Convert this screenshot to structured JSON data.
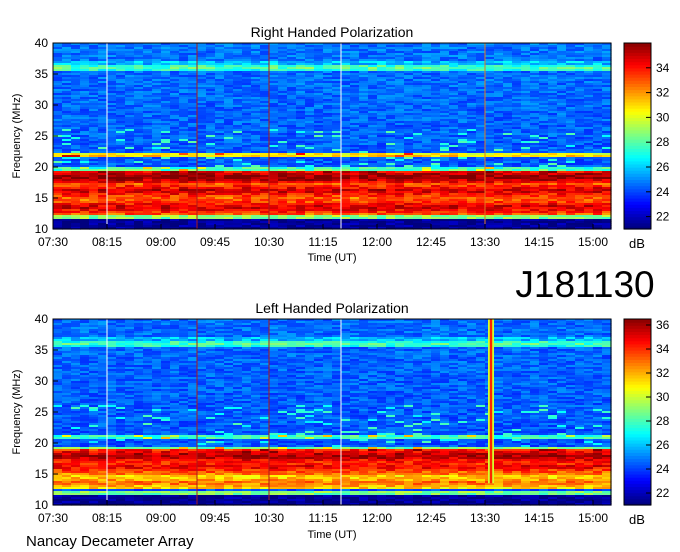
{
  "header": {
    "observation_id": "J181130"
  },
  "footer": {
    "instrument": "Nancay Decameter Array"
  },
  "chart_data": [
    {
      "type": "heatmap",
      "title": "Right Handed Polarization",
      "xlabel": "Time (UT)",
      "ylabel": "Frequency (MHz)",
      "x_ticks": [
        "07:30",
        "08:15",
        "09:00",
        "09:45",
        "10:30",
        "11:15",
        "12:00",
        "12:45",
        "13:30",
        "14:15",
        "15:00"
      ],
      "xlim": [
        "07:30",
        "15:15"
      ],
      "y_ticks": [
        10,
        15,
        20,
        25,
        30,
        35,
        40
      ],
      "ylim": [
        10,
        40
      ],
      "colorbar": {
        "label": "dB",
        "ticks": [
          22,
          24,
          26,
          28,
          30,
          32,
          34
        ],
        "range": [
          21,
          36
        ]
      },
      "colormap": [
        "#00007f",
        "#0000ff",
        "#007fff",
        "#00ffff",
        "#7fff7f",
        "#ffff00",
        "#ff7f00",
        "#ff0000",
        "#7f0000"
      ],
      "features": {
        "strong_bands_mhz": [
          {
            "freq": 12.0,
            "intensity": 29,
            "width": 0.4
          },
          {
            "freq": 13.5,
            "intensity": 35,
            "width": 1.4
          },
          {
            "freq": 14.8,
            "intensity": 33,
            "width": 0.5
          },
          {
            "freq": 16.2,
            "intensity": 35,
            "width": 1.4
          },
          {
            "freq": 17.3,
            "intensity": 31,
            "width": 0.5
          },
          {
            "freq": 18.4,
            "intensity": 36,
            "width": 1.0
          },
          {
            "freq": 19.6,
            "intensity": 28,
            "width": 0.4
          },
          {
            "freq": 21.8,
            "intensity": 31,
            "width": 0.3
          },
          {
            "freq": 36.0,
            "intensity": 28,
            "width": 0.6
          },
          {
            "freq": 36.8,
            "intensity": 26,
            "width": 0.3
          }
        ],
        "vertical_lines": [
          {
            "time": "08:15",
            "color": "#ffffff"
          },
          {
            "time": "09:30",
            "color": "#aa1a1a"
          },
          {
            "time": "10:30",
            "color": "#aa1a1a"
          },
          {
            "time": "11:30",
            "color": "#ffffff"
          },
          {
            "time": "13:30",
            "color": "#e07a20"
          }
        ],
        "bursts": []
      }
    },
    {
      "type": "heatmap",
      "title": "Left Handed Polarization",
      "xlabel": "Time (UT)",
      "ylabel": "Frequency (MHz)",
      "x_ticks": [
        "07:30",
        "08:15",
        "09:00",
        "09:45",
        "10:30",
        "11:15",
        "12:00",
        "12:45",
        "13:30",
        "14:15",
        "15:00"
      ],
      "xlim": [
        "07:30",
        "15:15"
      ],
      "y_ticks": [
        10,
        15,
        20,
        25,
        30,
        35,
        40
      ],
      "ylim": [
        10,
        40
      ],
      "colorbar": {
        "label": "dB",
        "ticks": [
          22,
          24,
          26,
          28,
          30,
          32,
          34,
          36
        ],
        "range": [
          21,
          36.5
        ]
      },
      "colormap": [
        "#00007f",
        "#0000ff",
        "#007fff",
        "#00ffff",
        "#7fff7f",
        "#ffff00",
        "#ff7f00",
        "#ff0000",
        "#7f0000"
      ],
      "features": {
        "strong_bands_mhz": [
          {
            "freq": 12.0,
            "intensity": 29,
            "width": 0.4
          },
          {
            "freq": 13.6,
            "intensity": 33,
            "width": 1.0
          },
          {
            "freq": 15.0,
            "intensity": 32,
            "width": 0.5
          },
          {
            "freq": 16.2,
            "intensity": 35,
            "width": 1.2
          },
          {
            "freq": 17.9,
            "intensity": 36,
            "width": 1.0
          },
          {
            "freq": 19.0,
            "intensity": 29,
            "width": 0.4
          },
          {
            "freq": 21.0,
            "intensity": 28,
            "width": 0.3
          },
          {
            "freq": 36.0,
            "intensity": 28,
            "width": 0.6
          },
          {
            "freq": 36.8,
            "intensity": 26,
            "width": 0.3
          }
        ],
        "vertical_lines": [
          {
            "time": "08:15",
            "color": "#ffffff"
          },
          {
            "time": "09:30",
            "color": "#aa1a1a"
          },
          {
            "time": "10:30",
            "color": "#aa1a1a"
          },
          {
            "time": "11:30",
            "color": "#ffffff"
          }
        ],
        "bursts": [
          {
            "time": "13:35",
            "from_mhz": 13.5,
            "to_mhz": 40,
            "intensity": 34
          }
        ]
      }
    }
  ]
}
